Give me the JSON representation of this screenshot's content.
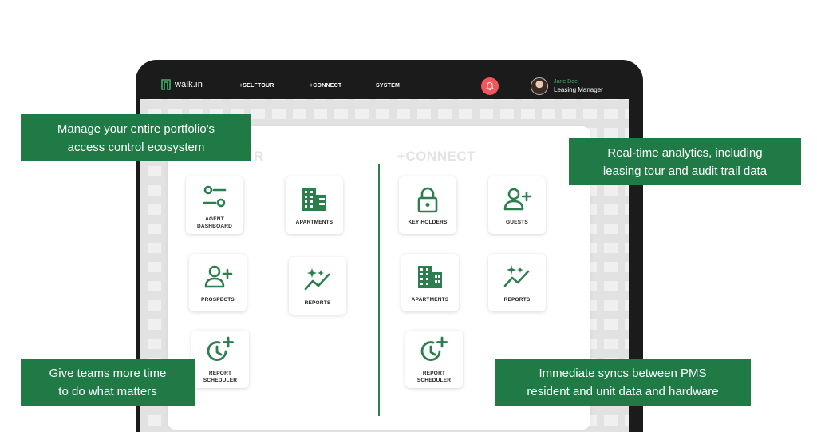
{
  "app": {
    "logo_text": "walk.in",
    "nav": [
      "+SELFTOUR",
      "+CONNECT",
      "SYSTEM"
    ],
    "user": {
      "name": "Jane Doe",
      "role": "Leasing Manager"
    }
  },
  "sections": {
    "left_title": "R",
    "right_title": "+CONNECT"
  },
  "left_tiles": [
    {
      "label": "AGENT\nDASHBOARD",
      "icon": "sliders-icon"
    },
    {
      "label": "APARTMENTS",
      "icon": "building-icon"
    },
    {
      "label": "PROSPECTS",
      "icon": "user-plus-icon"
    },
    {
      "label": "REPORTS",
      "icon": "sparkle-chart-icon"
    },
    {
      "label": "REPORT\nSCHEDULER",
      "icon": "clock-plus-icon"
    }
  ],
  "right_tiles": [
    {
      "label": "KEY HOLDERS",
      "icon": "lock-icon"
    },
    {
      "label": "GUESTS",
      "icon": "user-plus-icon"
    },
    {
      "label": "APARTMENTS",
      "icon": "building-icon"
    },
    {
      "label": "REPORTS",
      "icon": "sparkle-chart-icon"
    },
    {
      "label": "REPORT\nSCHEDULER",
      "icon": "clock-plus-icon"
    }
  ],
  "callouts": {
    "portfolio": "Manage your entire portfolio's\naccess control ecosystem",
    "analytics": "Real-time analytics, including\nleasing tour and audit trail data",
    "time": "Give teams more time\nto do what matters",
    "syncs": "Immediate syncs between PMS\nresident and unit data and hardware"
  },
  "colors": {
    "brand_green": "#1f7a45",
    "icon_green": "#2e7d4f",
    "bell_red": "#f2555a"
  }
}
